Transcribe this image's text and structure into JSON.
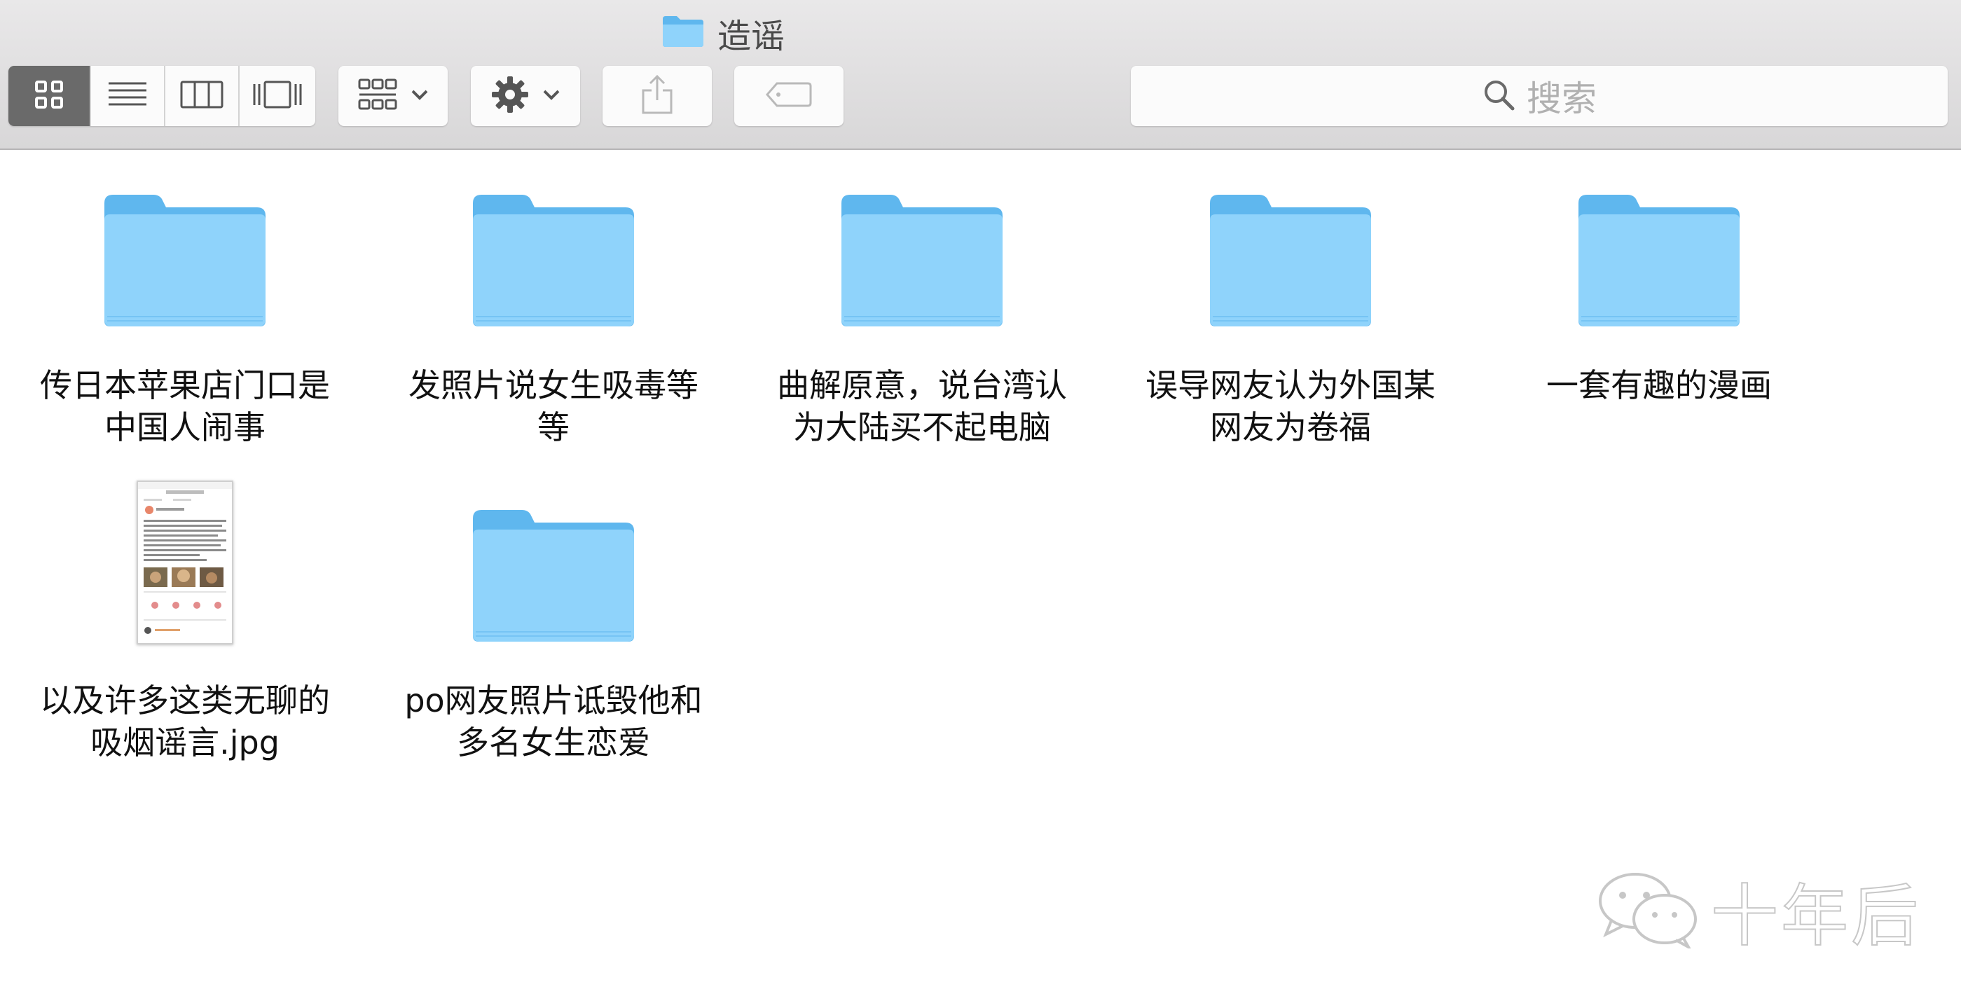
{
  "window": {
    "title": "造谣",
    "title_icon": "folder-icon"
  },
  "toolbar": {
    "view_modes": [
      {
        "name": "icon-view",
        "icon": "grid-icon",
        "active": true
      },
      {
        "name": "list-view",
        "icon": "list-icon",
        "active": false
      },
      {
        "name": "column-view",
        "icon": "columns-icon",
        "active": false
      },
      {
        "name": "cover-flow-view",
        "icon": "coverflow-icon",
        "active": false
      }
    ],
    "arrange_icon": "arrange-grid-icon",
    "action_icon": "gear-icon",
    "share_icon": "share-icon",
    "tags_icon": "tag-icon"
  },
  "search": {
    "placeholder": "搜索",
    "icon": "search-icon"
  },
  "items": [
    {
      "type": "folder",
      "label": "传日本苹果店门口是中国人闹事"
    },
    {
      "type": "folder",
      "label": "发照片说女生吸毒等等"
    },
    {
      "type": "folder",
      "label": "曲解原意，说台湾认为大陆买不起电脑"
    },
    {
      "type": "folder",
      "label": "误导网友认为外国某网友为卷福"
    },
    {
      "type": "folder",
      "label": "一套有趣的漫画"
    },
    {
      "type": "file",
      "label": "以及许多这类无聊的吸烟谣言.jpg"
    },
    {
      "type": "folder",
      "label": "po网友照片诋毁他和多名女生恋爱"
    }
  ],
  "watermark": {
    "text": "十年后",
    "icon": "wechat-icon"
  },
  "colors": {
    "folder_light": "#8fd3fb",
    "folder_dark": "#5fb7ee",
    "toolbar_bg": "#dedddf",
    "active_segment": "#6a6a6a"
  }
}
